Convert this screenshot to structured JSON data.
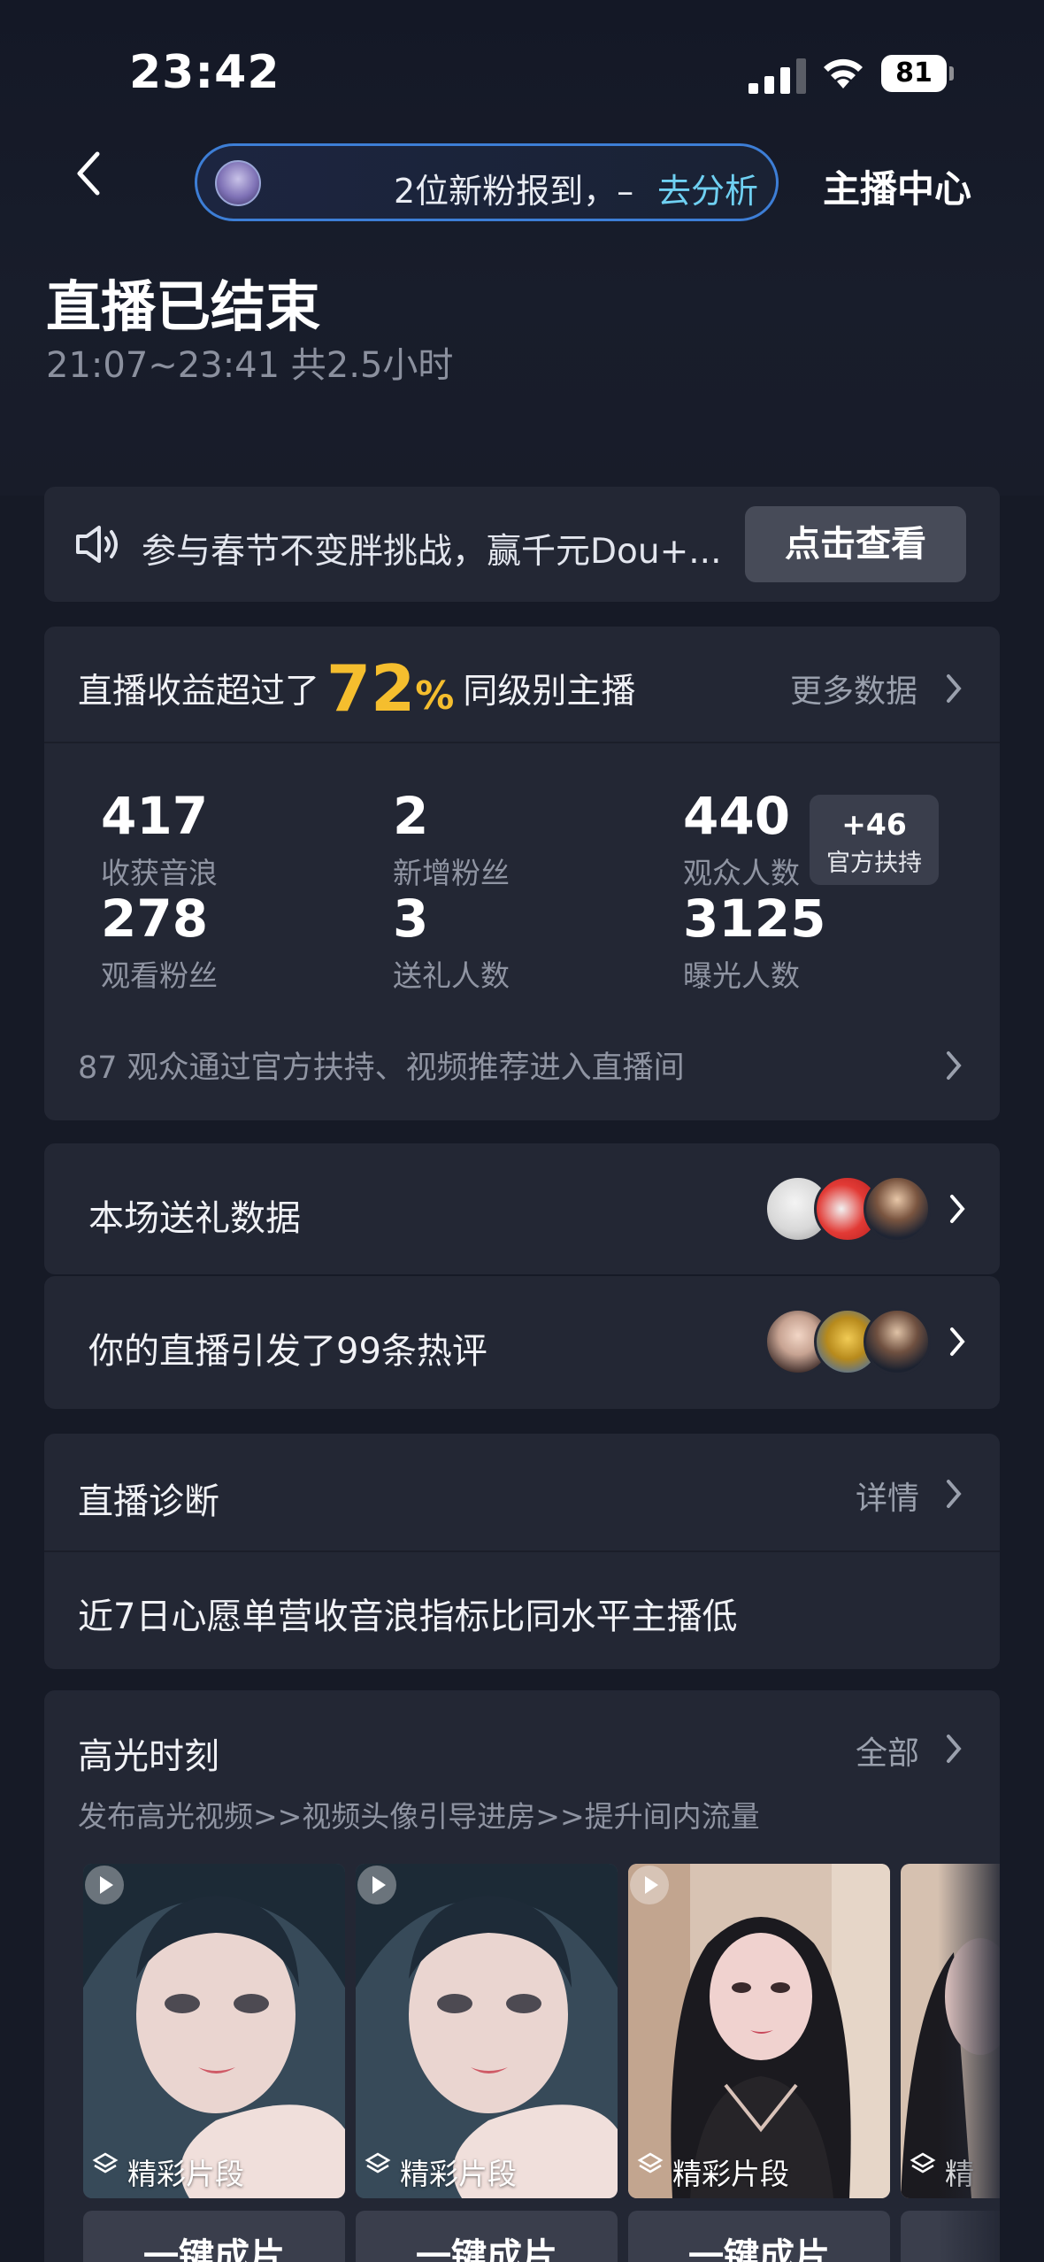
{
  "status_bar": {
    "time": "23:42",
    "battery": "81"
  },
  "nav": {
    "fan_text": "2位新粉报到，–",
    "fan_link": "去分析",
    "anchor_center": "主播中心"
  },
  "header": {
    "title": "直播已结束",
    "time_range": "21:07~23:41 共2.5小时"
  },
  "promo": {
    "text": "参与春节不变胖挑战，赢千元Dou+...",
    "button": "点击查看"
  },
  "revenue": {
    "prefix": "直播收益超过了",
    "percent": "72",
    "percent_sign": "%",
    "suffix": "同级别主播",
    "more": "更多数据",
    "stats": [
      {
        "value": "417",
        "label": "收获音浪"
      },
      {
        "value": "2",
        "label": "新增粉丝"
      },
      {
        "value": "440",
        "label": "观众人数"
      },
      {
        "value": "278",
        "label": "观看粉丝"
      },
      {
        "value": "3",
        "label": "送礼人数"
      },
      {
        "value": "3125",
        "label": "曝光人数"
      }
    ],
    "support_badge": {
      "delta": "+46",
      "label": "官方扶持"
    },
    "viewers_note": "87 观众通过官方扶持、视频推荐进入直播间"
  },
  "gift_row": {
    "title": "本场送礼数据"
  },
  "hot_row": {
    "title": "你的直播引发了99条热评"
  },
  "diagnosis": {
    "title": "直播诊断",
    "detail": "详情",
    "message": "近7日心愿单营收音浪指标比同水平主播低"
  },
  "highlights": {
    "title": "高光时刻",
    "all": "全部",
    "subtitle": "发布高光视频>>视频头像引导进房>>提升间内流量",
    "clips": [
      {
        "tag": "精彩片段",
        "button": "一键成片"
      },
      {
        "tag": "精彩片段",
        "button": "一键成片"
      },
      {
        "tag": "精彩片段",
        "button": "一键成片"
      },
      {
        "tag": "精",
        "button": "一"
      }
    ]
  },
  "colors": {
    "background": "#161a26",
    "card": "#232734",
    "accent_gold": "#f5be2e",
    "link_cyan": "#6fd0f2",
    "pill_border": "#3d7ed6"
  }
}
